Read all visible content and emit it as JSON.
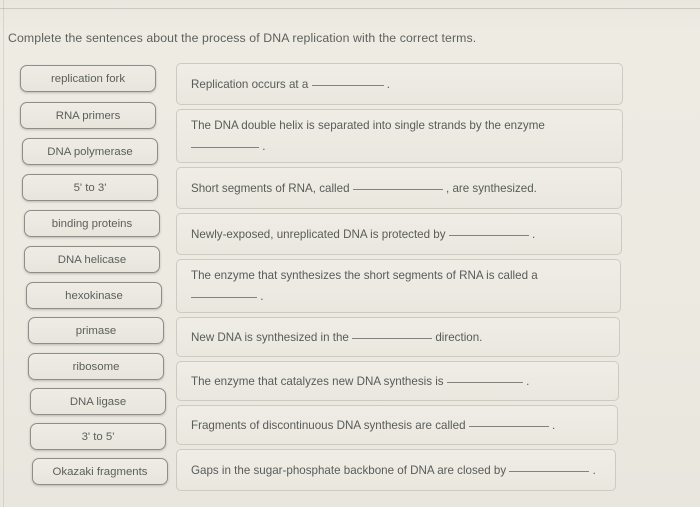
{
  "prompt": "Complete the sentences about the process of DNA replication with the correct terms.",
  "colors": {
    "page_background": "#eceae1",
    "chip_border": "#8d8d8a",
    "chip_fill": "#eeece4",
    "dropbox_border": "#cdcbc1",
    "text": "#585c59"
  },
  "terms": [
    {
      "label": "replication fork"
    },
    {
      "label": "RNA primers"
    },
    {
      "label": "DNA polymerase"
    },
    {
      "label": "5' to 3'"
    },
    {
      "label": "binding proteins"
    },
    {
      "label": "DNA helicase"
    },
    {
      "label": "hexokinase"
    },
    {
      "label": "primase"
    },
    {
      "label": "ribosome"
    },
    {
      "label": "DNA ligase"
    },
    {
      "label": "3' to 5'"
    },
    {
      "label": "Okazaki fragments"
    }
  ],
  "sentences": [
    {
      "line1_before": "Replication occurs at a",
      "line1_after": ".",
      "blank_on_line": 1,
      "line2_before": "",
      "line2_after": ""
    },
    {
      "line1_before": "The DNA double helix is separated into single strands by the enzyme",
      "line1_after": "",
      "blank_on_line": 2,
      "line2_before": "",
      "line2_after": "."
    },
    {
      "line1_before": "Short segments of RNA, called",
      "line1_after": ", are synthesized.",
      "blank_on_line": 1,
      "line2_before": "",
      "line2_after": ""
    },
    {
      "line1_before": "Newly-exposed, unreplicated DNA is protected by",
      "line1_after": ".",
      "blank_on_line": 1,
      "line2_before": "",
      "line2_after": ""
    },
    {
      "line1_before": "The enzyme that synthesizes the short segments of RNA is called a",
      "line1_after": "",
      "blank_on_line": 2,
      "line2_before": "",
      "line2_after": "."
    },
    {
      "line1_before": "New DNA is synthesized in the",
      "line1_after": "direction.",
      "blank_on_line": 1,
      "line2_before": "",
      "line2_after": ""
    },
    {
      "line1_before": "The enzyme that catalyzes new DNA synthesis is",
      "line1_after": ".",
      "blank_on_line": 1,
      "line2_before": "",
      "line2_after": ""
    },
    {
      "line1_before": "Fragments of discontinuous DNA synthesis are called",
      "line1_after": ".",
      "blank_on_line": 1,
      "line2_before": "",
      "line2_after": ""
    },
    {
      "line1_before": "Gaps in the sugar-phosphate backbone of DNA are closed by",
      "line1_after": ".",
      "blank_on_line": 1,
      "line2_before": "",
      "line2_after": ""
    }
  ]
}
